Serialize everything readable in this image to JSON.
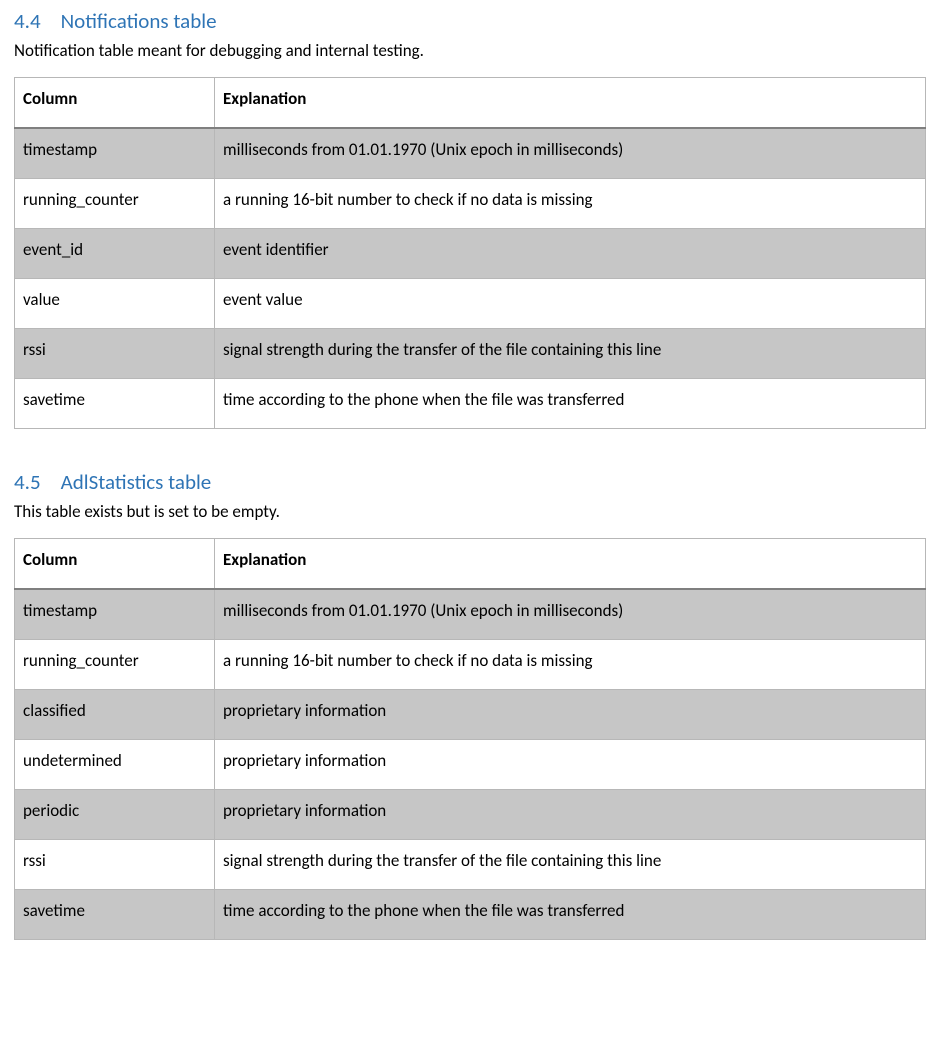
{
  "sections": [
    {
      "num": "4.4",
      "title": "Notifications table",
      "intro": "Notification table meant for debugging and internal testing.",
      "headers": {
        "col": "Column",
        "exp": "Explanation"
      },
      "rows": [
        {
          "col": "timestamp",
          "exp": "milliseconds from 01.01.1970 (Unix epoch in milliseconds)"
        },
        {
          "col": "running_counter",
          "exp": "a running 16-bit number to check if no data is missing"
        },
        {
          "col": "event_id",
          "exp": "event identifier"
        },
        {
          "col": "value",
          "exp": "event value"
        },
        {
          "col": "rssi",
          "exp": "signal strength during the transfer of the file containing this line"
        },
        {
          "col": "savetime",
          "exp": "time according to the phone when the file was transferred"
        }
      ]
    },
    {
      "num": "4.5",
      "title": "AdlStatistics table",
      "intro": "This table exists but is set to be empty.",
      "headers": {
        "col": "Column",
        "exp": "Explanation"
      },
      "rows": [
        {
          "col": "timestamp",
          "exp": "milliseconds from 01.01.1970 (Unix epoch in milliseconds)"
        },
        {
          "col": "running_counter",
          "exp": "a running 16-bit number to check if no data is missing"
        },
        {
          "col": "classified",
          "exp": "proprietary information"
        },
        {
          "col": "undetermined",
          "exp": "proprietary information"
        },
        {
          "col": "periodic",
          "exp": "proprietary information"
        },
        {
          "col": "rssi",
          "exp": "signal strength during the transfer of the file containing this line"
        },
        {
          "col": "savetime",
          "exp": "time according to the phone when the file was transferred"
        }
      ]
    }
  ]
}
